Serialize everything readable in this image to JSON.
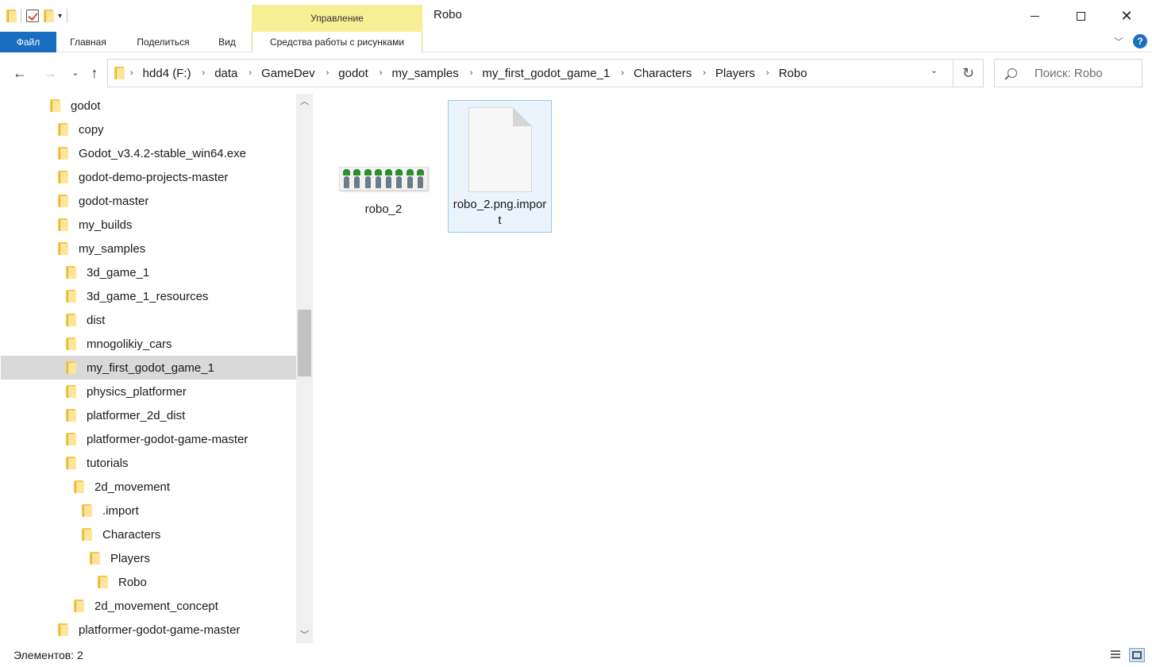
{
  "window": {
    "title": "Robo",
    "contextual_tab_group": "Управление"
  },
  "quick_access": {
    "icons": [
      "folder-icon",
      "properties-check-icon",
      "new-folder-icon",
      "customize-dropdown-icon"
    ]
  },
  "ribbon": {
    "tabs": [
      "Файл",
      "Главная",
      "Поделиться",
      "Вид",
      "Средства работы с рисунками"
    ],
    "active_color": "#1a6ec1",
    "contextual_color": "#f7ef94"
  },
  "address": {
    "crumbs": [
      "hdd4 (F:)",
      "data",
      "GameDev",
      "godot",
      "my_samples",
      "my_first_godot_game_1",
      "Characters",
      "Players",
      "Robo"
    ]
  },
  "search": {
    "placeholder": "Поиск: Robo"
  },
  "nav_tree": [
    {
      "label": "godot",
      "selected": false
    },
    {
      "label": "copy",
      "selected": false
    },
    {
      "label": "Godot_v3.4.2-stable_win64.exe",
      "selected": false
    },
    {
      "label": "godot-demo-projects-master",
      "selected": false
    },
    {
      "label": "godot-master",
      "selected": false
    },
    {
      "label": "my_builds",
      "selected": false
    },
    {
      "label": "my_samples",
      "selected": false
    },
    {
      "label": "3d_game_1",
      "selected": false
    },
    {
      "label": "3d_game_1_resources",
      "selected": false
    },
    {
      "label": "dist",
      "selected": false
    },
    {
      "label": "mnogolikiy_cars",
      "selected": false
    },
    {
      "label": "my_first_godot_game_1",
      "selected": true
    },
    {
      "label": "physics_platformer",
      "selected": false
    },
    {
      "label": "platformer_2d_dist",
      "selected": false
    },
    {
      "label": "platformer-godot-game-master",
      "selected": false
    },
    {
      "label": "tutorials",
      "selected": false
    },
    {
      "label": "2d_movement",
      "selected": false
    },
    {
      "label": ".import",
      "selected": false
    },
    {
      "label": "Characters",
      "selected": false
    },
    {
      "label": "Players",
      "selected": false
    },
    {
      "label": "Robo",
      "selected": false
    },
    {
      "label": "2d_movement_concept",
      "selected": false
    },
    {
      "label": "platformer-godot-game-master",
      "selected": false
    }
  ],
  "files": [
    {
      "name": "robo_2",
      "icon": "sprite-thumbnail-icon",
      "selected": false
    },
    {
      "name": "robo_2.png.import",
      "icon": "document-icon",
      "selected": true
    }
  ],
  "status": {
    "text": "Элементов: 2"
  }
}
